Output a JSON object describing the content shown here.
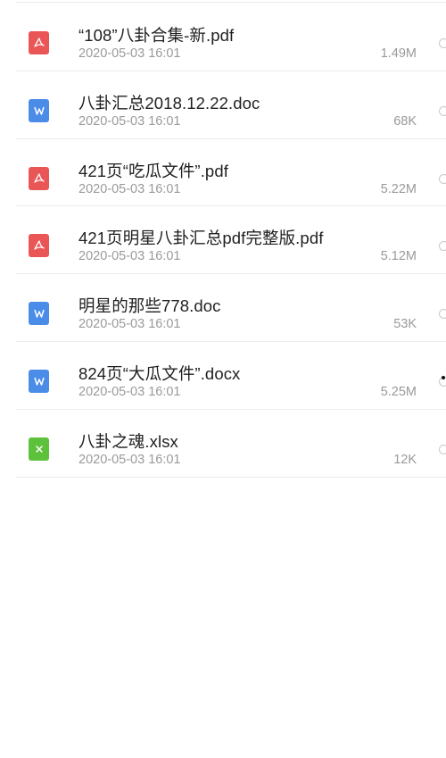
{
  "files": [
    {
      "name": "“108”八卦合集-新.pdf",
      "date": "2020-05-03 16:01",
      "size": "1.49M",
      "type": "pdf",
      "icon": "pdf-file-icon"
    },
    {
      "name": "八卦汇总2018.12.22.doc",
      "date": "2020-05-03 16:01",
      "size": "68K",
      "type": "doc",
      "icon": "word-file-icon"
    },
    {
      "name": "421页“吃瓜文件”.pdf",
      "date": "2020-05-03 16:01",
      "size": "5.22M",
      "type": "pdf",
      "icon": "pdf-file-icon"
    },
    {
      "name": "421页明星八卦汇总pdf完整版.pdf",
      "date": "2020-05-03 16:01",
      "size": "5.12M",
      "type": "pdf",
      "icon": "pdf-file-icon"
    },
    {
      "name": "明星的那些778.doc",
      "date": "2020-05-03 16:01",
      "size": "53K",
      "type": "doc",
      "icon": "word-file-icon"
    },
    {
      "name": "824页“大瓜文件”.docx",
      "date": "2020-05-03 16:01",
      "size": "5.25M",
      "type": "doc",
      "icon": "word-file-icon"
    },
    {
      "name": "八卦之魂.xlsx",
      "date": "2020-05-03 16:01",
      "size": "12K",
      "type": "xls",
      "icon": "excel-file-icon"
    }
  ],
  "colors": {
    "pdf": "#ea5656",
    "doc": "#4a8ce8",
    "xls": "#5ec13b",
    "text": "#1f1f1f",
    "meta": "#9a9a9a"
  }
}
